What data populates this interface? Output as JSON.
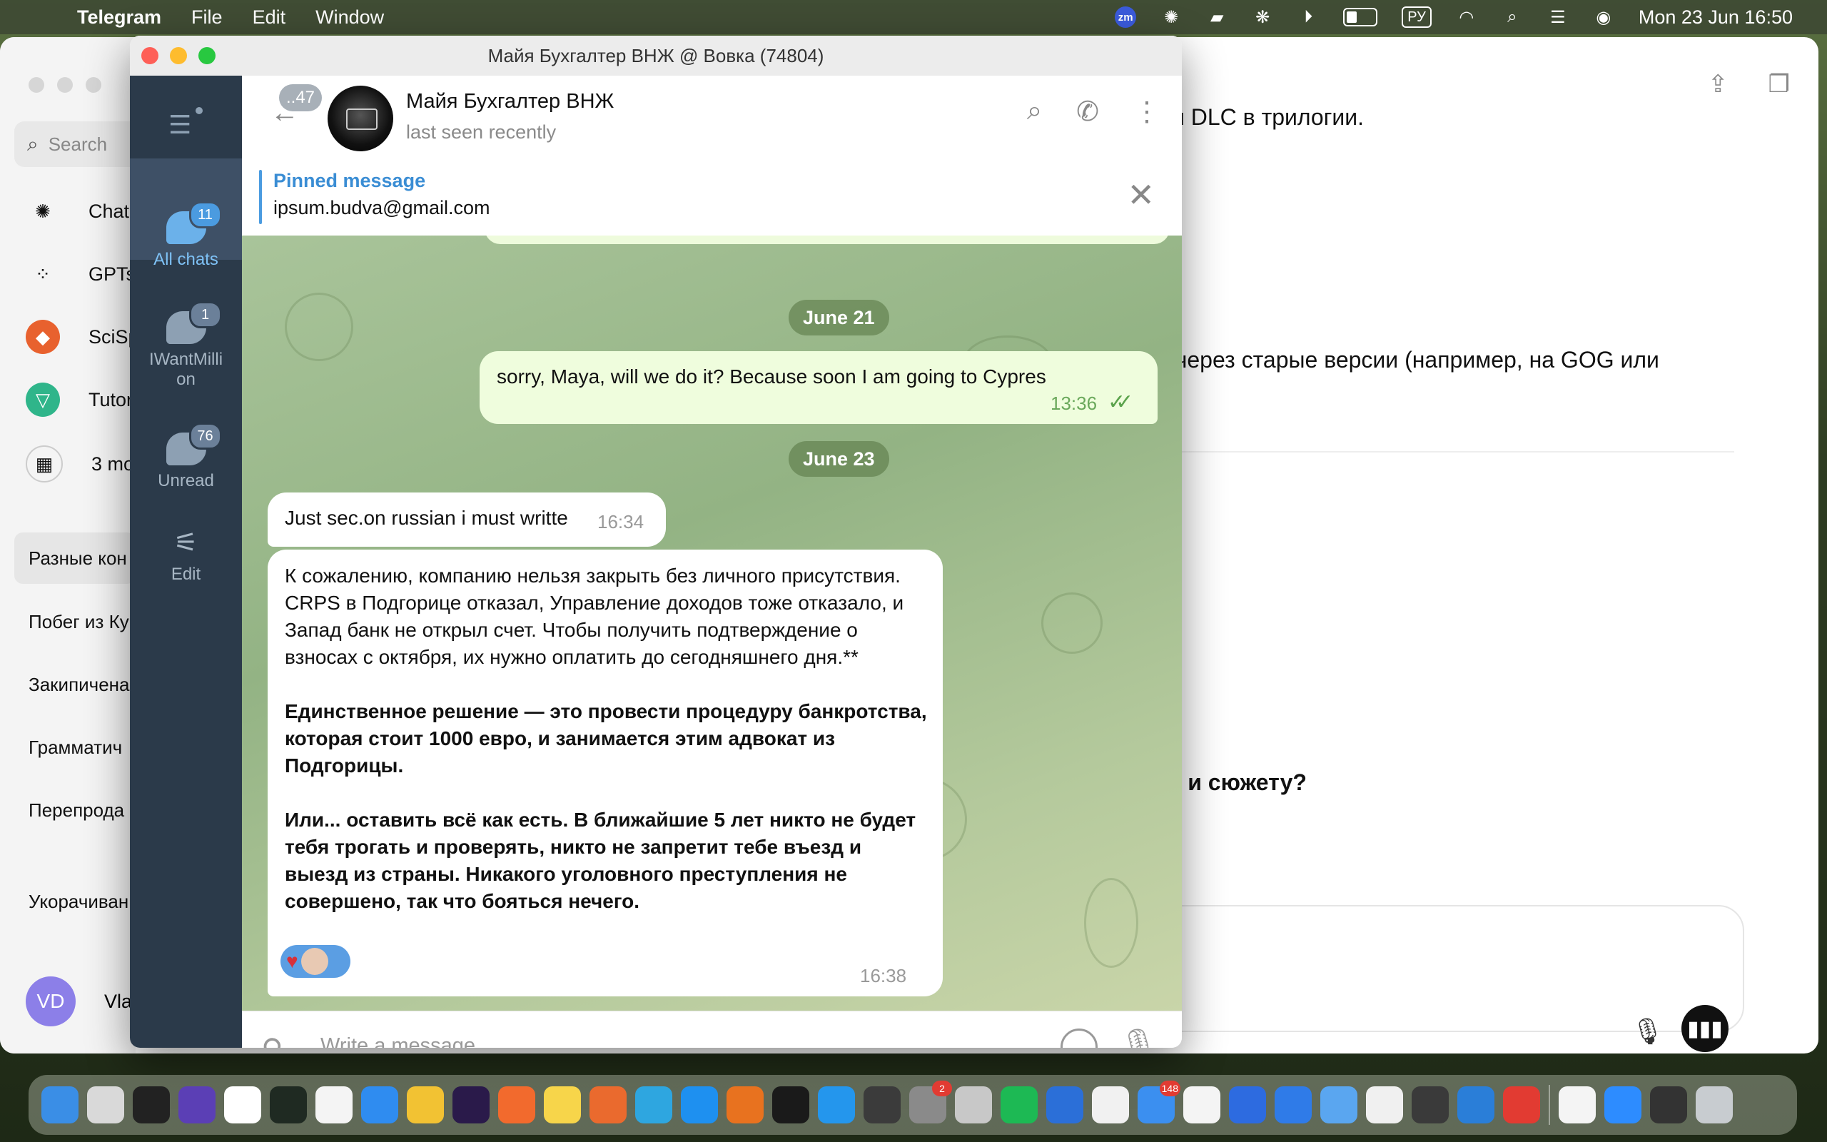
{
  "menubar": {
    "app_name": "Telegram",
    "menus": [
      "File",
      "Edit",
      "Window"
    ],
    "zoom_label": "zm",
    "keyboard_layout": "РУ",
    "clock": "Mon 23 Jun  16:50"
  },
  "background_window": {
    "search_placeholder": "Search",
    "nav_items": [
      "ChatG",
      "GPTs",
      "SciSp",
      "Tutor",
      "3 mo"
    ],
    "conversations": [
      "Разные кон",
      "Побег из Ку",
      "Закипичена",
      "Грамматич",
      "Перепрода",
      "Укорачиван"
    ],
    "user_initials": "VD",
    "user_name": "Vlad",
    "content_lines": [
      "им DLC в трилогии.",
      "о через старые версии (например, на GOG или",
      "ти и сюжету?"
    ]
  },
  "telegram": {
    "window_title": "Майя Бухгалтер ВНЖ @ Вовка (74804)",
    "folders": [
      {
        "label": "All chats",
        "badge": "11"
      },
      {
        "label": "IWantMillion",
        "label_line1": "IWantMilli",
        "label_line2": "on",
        "badge": "1"
      },
      {
        "label": "Unread",
        "badge": "76"
      },
      {
        "label": "Edit"
      }
    ],
    "header": {
      "back_badge": "..47",
      "chat_name": "Майя Бухгалтер ВНЖ",
      "status": "last seen recently"
    },
    "pinned": {
      "title": "Pinned message",
      "text": "ipsum.budva@gmail.com"
    },
    "messages": {
      "date1": "June 21",
      "out1_text": "sorry, Maya, will we do it? Because soon I am going to Cypres",
      "out1_time": "13:36",
      "date2": "June 23",
      "in1_text": "Just sec.on russian i must writte",
      "in1_time": "16:34",
      "in2_p1": "К сожалению, компанию нельзя закрыть без личного присутствия. CRPS в Подгорице отказал, Управление доходов тоже отказало, и Запад банк не открыл счет. Чтобы получить подтверждение о взносах с октября, их нужно оплатить до сегодняшнего дня.**",
      "in2_p2": "Единственное решение — это провести процедуру банкротства, которая стоит 1000 евро, и занимается этим адвокат из Подгорицы.",
      "in2_p3": "Или... оставить всё как есть. В ближайшие 5 лет никто не будет тебя трогать и проверять, никто не запретит тебе въезд и выезд из страны. Никакого уголовного преступления не совершено, так что бояться нечего.",
      "in2_time": "16:38"
    },
    "composer_placeholder": "Write a message..."
  },
  "dock": {
    "apps": [
      {
        "name": "finder",
        "color": "#3a8ee6"
      },
      {
        "name": "launchpad",
        "color": "#d9d9d9"
      },
      {
        "name": "terminal",
        "color": "#222222"
      },
      {
        "name": "siri",
        "color": "#5b3fb5"
      },
      {
        "name": "chatgpt",
        "color": "#ffffff"
      },
      {
        "name": "activity-monitor",
        "color": "#1f2a22"
      },
      {
        "name": "yandex-browser",
        "color": "#f4f4f4"
      },
      {
        "name": "safari",
        "color": "#2f8cf0"
      },
      {
        "name": "chrome",
        "color": "#f2c233"
      },
      {
        "name": "opera",
        "color": "#2a1a4a"
      },
      {
        "name": "firefox",
        "color": "#f26a2d"
      },
      {
        "name": "notes",
        "color": "#f7d54a"
      },
      {
        "name": "pixelmator",
        "color": "#ea6a2e"
      },
      {
        "name": "telegram",
        "color": "#2ea6e0"
      },
      {
        "name": "app-store",
        "color": "#1e90f0"
      },
      {
        "name": "fus",
        "color": "#e8721f"
      },
      {
        "name": "box",
        "color": "#1a1a1a"
      },
      {
        "name": "docker",
        "color": "#2496ed"
      },
      {
        "name": "sublime",
        "color": "#3b3b3b"
      },
      {
        "name": "system-settings",
        "color": "#8a8a8a",
        "badge": "2"
      },
      {
        "name": "transmit",
        "color": "#c8c8c8"
      },
      {
        "name": "spotify",
        "color": "#1db954"
      },
      {
        "name": "rider",
        "color": "#2b6fd8"
      },
      {
        "name": "w-app",
        "color": "#f1f1f1"
      },
      {
        "name": "mail",
        "color": "#3b8ff0",
        "badge": "148"
      },
      {
        "name": "preview",
        "color": "#f4f4f4"
      },
      {
        "name": "c-app",
        "color": "#2d6be0"
      },
      {
        "name": "files",
        "color": "#2f7be8"
      },
      {
        "name": "testflight",
        "color": "#5aa6f0"
      },
      {
        "name": "focus",
        "color": "#f0f0f0"
      },
      {
        "name": "simulator",
        "color": "#3a3a3a"
      },
      {
        "name": "vscode",
        "color": "#2a7ed8"
      },
      {
        "name": "anydesk",
        "color": "#e23b32"
      },
      {
        "name": "textedit",
        "color": "#f4f4f4"
      },
      {
        "name": "zoom",
        "color": "#2d8cff"
      },
      {
        "name": "screen",
        "color": "#333333"
      },
      {
        "name": "trash",
        "color": "#c8ccd0"
      }
    ]
  }
}
